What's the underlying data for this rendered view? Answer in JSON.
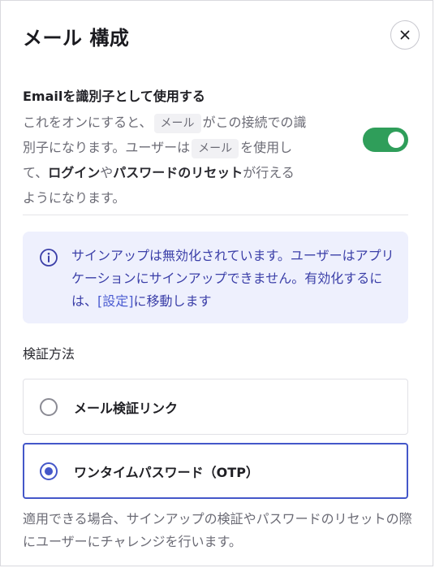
{
  "header": {
    "title": "メール 構成",
    "close_icon": "close-icon"
  },
  "email_identifier": {
    "title": "Emailを識別子として使用する",
    "desc_1": "これをオンにすると、",
    "code_1": "メール",
    "desc_2": "がこの接続での識別子になります。ユーザーは",
    "code_2": "メール",
    "desc_3": "を使用して、",
    "bold_1": "ログイン",
    "desc_4": "や",
    "bold_2": "パスワードのリセット",
    "desc_5": "が行えるようになります。",
    "toggle_on": true,
    "toggle_color": "#2f9e5a"
  },
  "info_banner": {
    "icon": "info-icon",
    "text_1": "サインアップは無効化されています。ユーザーはアプリケーションにサインアップできません。有効化するには、",
    "link": "[設定]",
    "text_2": "に移動します",
    "background": "#eef0fd",
    "text_color": "#3b3fa8"
  },
  "verification": {
    "label": "検証方法",
    "options": [
      {
        "label": "メール検証リンク",
        "selected": false
      },
      {
        "label": "ワンタイムパスワード（OTP）",
        "selected": true
      }
    ],
    "accent_color": "#4457c9"
  },
  "footer": {
    "text": "適用できる場合、サインアップの検証やパスワードのリセットの際にユーザーにチャレンジを行います。"
  }
}
